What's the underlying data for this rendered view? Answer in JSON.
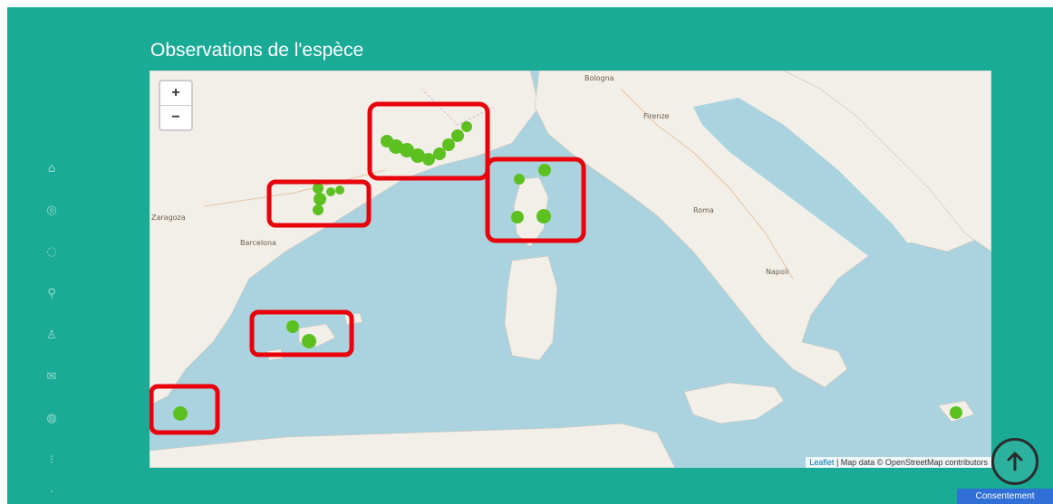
{
  "section": {
    "title": "Observations de l'espèce"
  },
  "map": {
    "zoom_in_label": "+",
    "zoom_out_label": "−",
    "attribution_leaflet": "Leaflet",
    "attribution_text": "| Map data © OpenStreetMap contributors",
    "place_labels": [
      "Zaragoza",
      "Barcelona",
      "Bologna",
      "Firenze",
      "Roma",
      "Napoli"
    ],
    "observation_color": "#5cc021",
    "highlight_color": "#e8000b",
    "water_color": "#aad3df",
    "land_color": "#f2efe9",
    "highlighted_groups": [
      "Côte d'Azur / Ligurie",
      "Catalogne (nord-est)",
      "Corse / Archipel toscan",
      "Baléares",
      "Sud-est de l'Espagne"
    ]
  },
  "sidebar": {
    "icons": [
      "home-icon",
      "info-icon",
      "leaf-icon",
      "search-icon",
      "user-icon",
      "mail-icon",
      "chart-icon",
      "settings-icon",
      "more-icon"
    ]
  },
  "scroll_top": {
    "icon": "arrow-up-icon"
  },
  "consent": {
    "label": "Consentement"
  },
  "colors": {
    "accent": "#1aab96"
  }
}
